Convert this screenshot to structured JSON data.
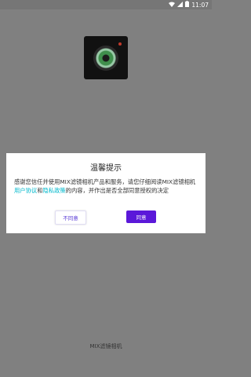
{
  "status_bar": {
    "time": "11:07",
    "icons": [
      "wifi-icon",
      "signal-icon",
      "battery-icon"
    ]
  },
  "app_icon": {
    "name": "camera-lens-icon"
  },
  "dialog": {
    "title": "温馨提示",
    "body_prefix": "感谢您信任并使用MIX滤镜相机产品和服务，请您仔细阅读MIX滤镜相机",
    "user_agreement_link": "用户协议",
    "and_text": "和",
    "privacy_policy_link": "隐私政策",
    "body_suffix": "的内容，并作出是否全部同意授权的决定",
    "disagree_label": "不同意",
    "agree_label": "同意"
  },
  "footer": {
    "app_name": "MIX滤镜相机"
  },
  "colors": {
    "accent": "#5b18d9",
    "link": "#00b8cc",
    "overlay": "#808080"
  }
}
